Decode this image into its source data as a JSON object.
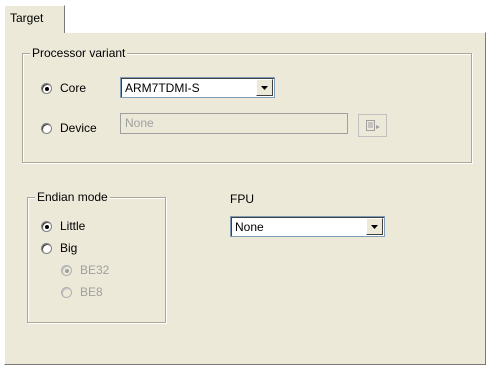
{
  "tab": {
    "label": "Target"
  },
  "processor": {
    "legend": "Processor variant",
    "core_label": "Core",
    "core_value": "ARM7TDMI-S",
    "device_label": "Device",
    "device_value": "None"
  },
  "endian": {
    "legend": "Endian mode",
    "little_label": "Little",
    "big_label": "Big",
    "be32_label": "BE32",
    "be8_label": "BE8"
  },
  "fpu": {
    "label": "FPU",
    "value": "None"
  }
}
